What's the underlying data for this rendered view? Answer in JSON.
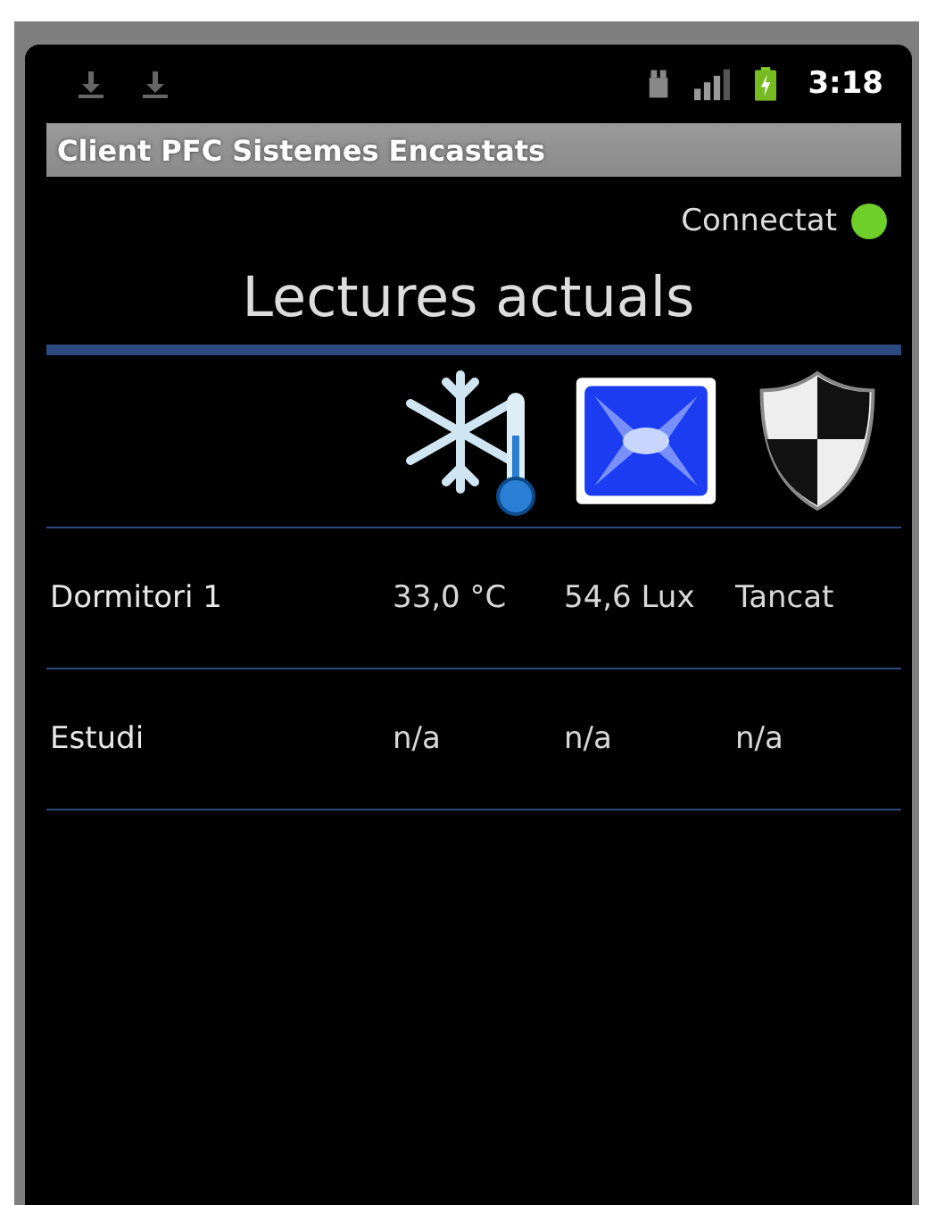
{
  "status_bar": {
    "time": "3:18",
    "notifications": [
      {
        "kind": "download"
      },
      {
        "kind": "download"
      }
    ]
  },
  "app_bar": {
    "title": "Client PFC Sistemes Encastats"
  },
  "connection": {
    "label": "Connectat",
    "connected": true
  },
  "heading": "Lectures actuals",
  "columns": [
    {
      "kind": "temperature"
    },
    {
      "kind": "light"
    },
    {
      "kind": "security"
    }
  ],
  "rows": [
    {
      "room": "Dormitori 1",
      "values": [
        "33,0 °C",
        "54,6 Lux",
        "Tancat"
      ]
    },
    {
      "room": "Estudi",
      "values": [
        "n/a",
        "n/a",
        "n/a"
      ]
    }
  ]
}
